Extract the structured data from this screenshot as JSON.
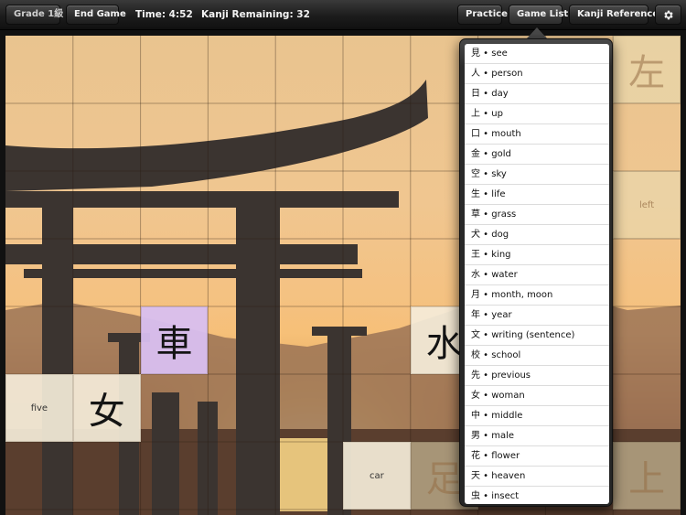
{
  "toolbar": {
    "grade_label": "Grade 1級",
    "end_game_label": "End Game",
    "time_text": "Time:  4:52",
    "kanji_remaining_text": "Kanji Remaining: 32",
    "practice_label": "Practice",
    "game_list_label": "Game List",
    "kanji_reference_label": "Kanji Reference",
    "settings_icon": "gear-icon"
  },
  "board": {
    "tiles": [
      {
        "row": 0,
        "col": 9,
        "text": "左",
        "kind": "kanji",
        "style": "faded"
      },
      {
        "row": 2,
        "col": 9,
        "text": "left",
        "kind": "word",
        "style": "faded"
      },
      {
        "row": 4,
        "col": 2,
        "text": "車",
        "kind": "kanji",
        "style": "selected"
      },
      {
        "row": 4,
        "col": 6,
        "text": "水",
        "kind": "kanji",
        "style": "light"
      },
      {
        "row": 5,
        "col": 0,
        "text": "five",
        "kind": "word",
        "style": "light"
      },
      {
        "row": 5,
        "col": 1,
        "text": "女",
        "kind": "kanji",
        "style": "light"
      },
      {
        "row": 6,
        "col": 5,
        "text": "car",
        "kind": "word",
        "style": "light"
      },
      {
        "row": 6,
        "col": 6,
        "text": "足",
        "kind": "kanji",
        "style": "faded"
      },
      {
        "row": 6,
        "col": 9,
        "text": "上",
        "kind": "kanji",
        "style": "faded"
      }
    ]
  },
  "game_list": {
    "items": [
      "見 • see",
      "人 • person",
      "日 • day",
      "上 • up",
      "口 • mouth",
      "金 • gold",
      "空 • sky",
      "生 • life",
      "草 • grass",
      "犬 • dog",
      "王 • king",
      "水 • water",
      "月 • month, moon",
      "年 • year",
      "文 • writing (sentence)",
      "校 • school",
      "先 • previous",
      "女 • woman",
      "中 • middle",
      "男 • male",
      "花 • flower",
      "天 • heaven",
      "虫 • insect"
    ]
  },
  "colors": {
    "tile_light": "#f4ecd9",
    "tile_selected": "#d8bff0",
    "tile_faded": "#e7dcb4"
  }
}
